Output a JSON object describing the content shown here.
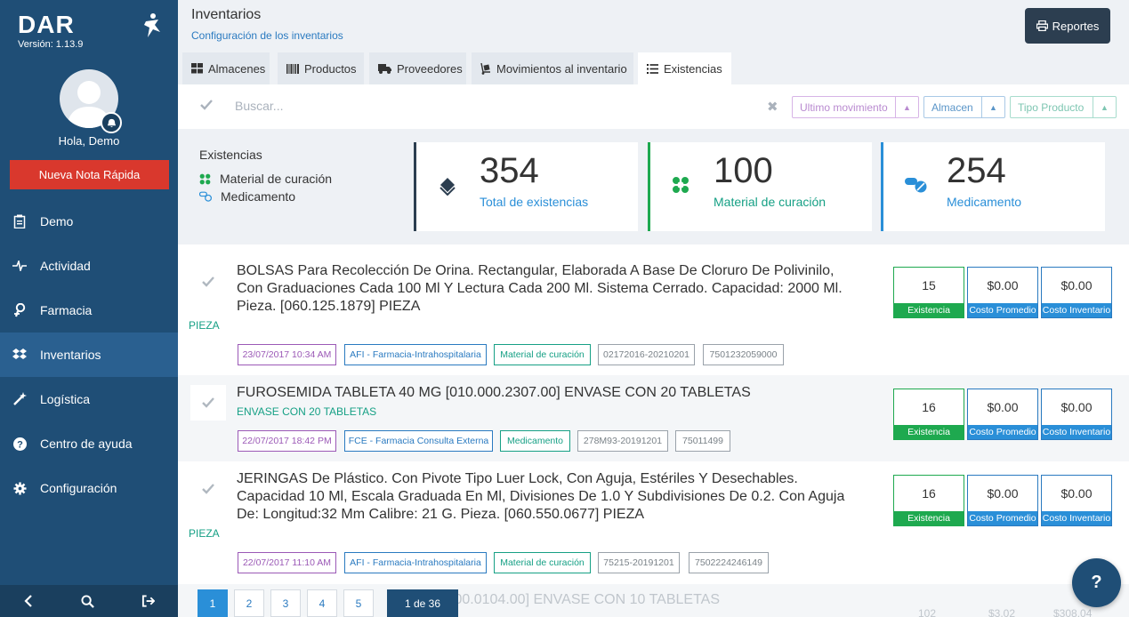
{
  "sidebar": {
    "brand": "DAR",
    "version": "Versión: 1.13.9",
    "greeting": "Hola, Demo",
    "quick_note": "Nueva Nota Rápida",
    "items": [
      {
        "label": "Demo",
        "icon": "clipboard-icon"
      },
      {
        "label": "Actividad",
        "icon": "pulse-icon"
      },
      {
        "label": "Farmacia",
        "icon": "pharmacy-icon"
      },
      {
        "label": "Inventarios",
        "icon": "dropbox-icon",
        "active": true
      },
      {
        "label": "Logística",
        "icon": "magic-wand-icon"
      },
      {
        "label": "Centro de ayuda",
        "icon": "question-circle-icon"
      },
      {
        "label": "Configuración",
        "icon": "gear-icon"
      }
    ]
  },
  "header": {
    "title": "Inventarios",
    "subtitle_link": "Configuración de los inventarios",
    "reports_button": "Reportes"
  },
  "tabs": [
    "Almacenes",
    "Productos",
    "Proveedores",
    "Movimientos al inventario",
    "Existencias"
  ],
  "search": {
    "placeholder": "Buscar...",
    "filters": [
      "Ultimo movimiento",
      "Almacen",
      "Tipo Producto"
    ]
  },
  "summary": {
    "legend_title": "Existencias",
    "legend": [
      "Material de curación",
      "Medicamento"
    ],
    "cards": [
      {
        "value": "354",
        "label": "Total de existencias"
      },
      {
        "value": "100",
        "label": "Material de curación"
      },
      {
        "value": "254",
        "label": "Medicamento"
      }
    ]
  },
  "items": [
    {
      "title": "BOLSAS Para Recolección De Orina. Rectangular, Elaborada A Base De Cloruro De Polivinilo, Con Graduaciones Cada 100 Ml Y Lectura Cada 200 Ml. Sistema Cerrado. Capacidad: 2000 Ml. Pieza. [060.125.1879] PIEZA",
      "unit": "PIEZA",
      "tags": [
        "23/07/2017 10:34 AM",
        "AFI - Farmacia-Intrahospitalaria",
        "Material de curación",
        "02172016-20210201",
        "7501232059000"
      ],
      "existencia": "15",
      "costo_promedio": "$0.00",
      "costo_inventario": "$0.00"
    },
    {
      "title": "FUROSEMIDA TABLETA 40 MG [010.000.2307.00] ENVASE CON 20 TABLETAS",
      "unit": "ENVASE CON 20 TABLETAS",
      "tags": [
        "22/07/2017 18:42 PM",
        "FCE - Farmacia Consulta Externa",
        "Medicamento",
        "278M93-20191201",
        "75011499"
      ],
      "existencia": "16",
      "costo_promedio": "$0.00",
      "costo_inventario": "$0.00"
    },
    {
      "title": "JERINGAS De Plástico. Con Pivote Tipo Luer Lock, Con Aguja, Estériles Y Desechables. Capacidad 10 Ml, Escala Graduada En Ml, Divisiones De 1.0 Y Subdivisiones De 0.2. Con Aguja De: Longitud:32 Mm Calibre: 21 G. Pieza. [060.550.0677] PIEZA",
      "unit": "PIEZA",
      "tags": [
        "22/07/2017 11:10 AM",
        "AFI - Farmacia-Intrahospitalaria",
        "Material de curación",
        "75215-20191201",
        "7502224246149"
      ],
      "existencia": "16",
      "costo_promedio": "$0.00",
      "costo_inventario": "$0.00"
    }
  ],
  "stat_labels": {
    "existencia": "Existencia",
    "costo_promedio": "Costo Promedio",
    "costo_inventario": "Costo Inventario"
  },
  "partial_row": {
    "title": "[010.000.0104.00] ENVASE CON 10 TABLETAS",
    "stats": [
      "102",
      "$3.02",
      "$308.04"
    ]
  },
  "pagination": {
    "pages": [
      "1",
      "2",
      "3",
      "4",
      "5"
    ],
    "count": "1 de 36"
  },
  "help_label": "?",
  "colors": {
    "sidebar": "#1f4e76",
    "accent_blue": "#2a7ac0",
    "green": "#1ea94f",
    "teal": "#16a085",
    "red": "#d9382d",
    "purple": "#9b59b6"
  }
}
